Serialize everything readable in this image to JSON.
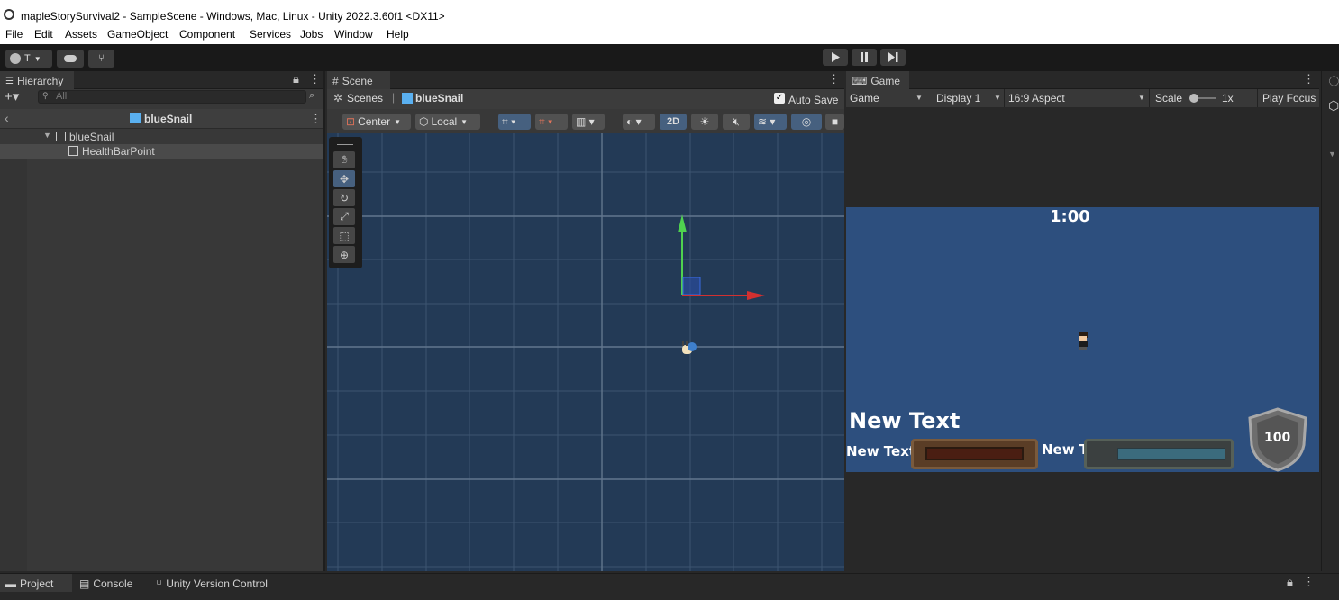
{
  "window": {
    "title": "mapleStorySurvival2 - SampleScene - Windows, Mac, Linux - Unity 2022.3.60f1 <DX11>"
  },
  "menu": [
    "File",
    "Edit",
    "Assets",
    "GameObject",
    "Component",
    "Services",
    "Jobs",
    "Window",
    "Help"
  ],
  "toolbar": {
    "account_label": "T",
    "play_icon": "play-icon",
    "pause_icon": "pause-icon",
    "step_icon": "step-icon"
  },
  "hierarchy": {
    "tab_label": "Hierarchy",
    "search_placeholder": "All",
    "prefab_title": "blueSnail",
    "items": [
      {
        "label": "blueSnail"
      },
      {
        "label": "HealthBarPoint"
      }
    ]
  },
  "scene": {
    "tab_label": "Scene",
    "breadcrumb_root": "Scenes",
    "breadcrumb_prefab": "blueSnail",
    "autosave_label": "Auto Save",
    "pivot_label": "Center",
    "space_label": "Local",
    "mode_2d_label": "2D"
  },
  "game": {
    "tab_label": "Game",
    "view_mode": "Game",
    "display": "Display 1",
    "aspect": "16:9 Aspect",
    "scale_label": "Scale",
    "scale_value": "1x",
    "play_focus": "Play Focus",
    "timer_text": "1:00",
    "big_text": "New Text",
    "hp_label": "New Text",
    "exp_label": "New Text",
    "level_value": "100"
  },
  "bottom": {
    "tabs": [
      "Project",
      "Console",
      "Unity Version Control"
    ]
  },
  "colors": {
    "scene_bg": "#233a56",
    "game_bg": "#2d4f7e",
    "panel_bg": "#383838",
    "dark_bg": "#282828"
  }
}
